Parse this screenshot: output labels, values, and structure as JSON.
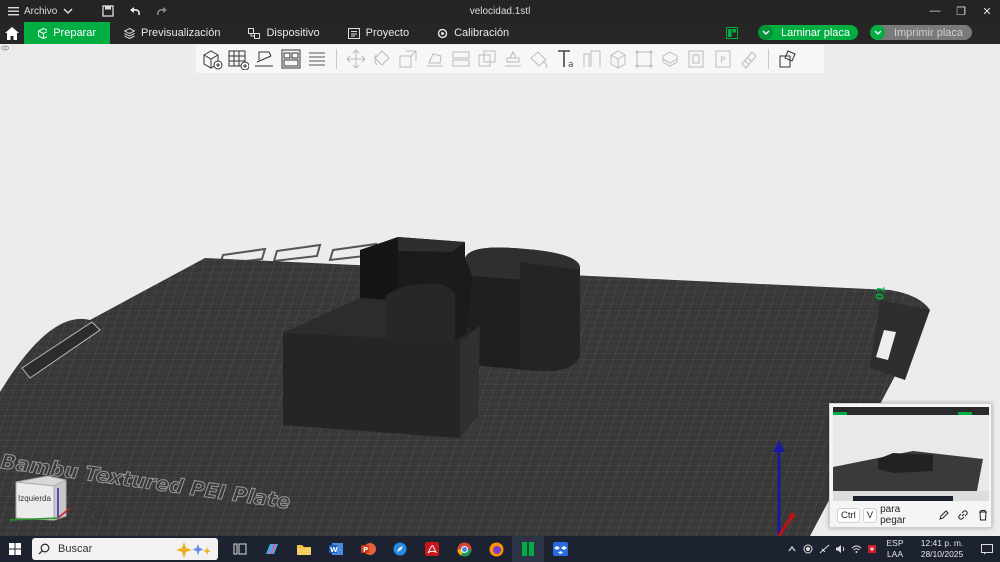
{
  "titlebar": {
    "menu_label": "Archivo",
    "document_title": "velocidad.1stl"
  },
  "nav": {
    "tabs": [
      {
        "label": "Preparar",
        "icon": "cube-icon",
        "active": true
      },
      {
        "label": "Previsualización",
        "icon": "layers-icon",
        "active": false
      },
      {
        "label": "Dispositivo",
        "icon": "device-icon",
        "active": false
      },
      {
        "label": "Proyecto",
        "icon": "project-icon",
        "active": false
      },
      {
        "label": "Calibración",
        "icon": "calibration-icon",
        "active": false
      }
    ],
    "slice_label": "Laminar placa",
    "print_label": "Imprimir placa"
  },
  "toolbar": {
    "tools": [
      "add-object",
      "add-plate",
      "auto-orient",
      "arrange",
      "layer-list",
      "move",
      "rotate",
      "scale",
      "lay-on-face",
      "cut",
      "mesh-boolean",
      "support-paint",
      "seam-paint",
      "text-tool",
      "measure",
      "assembly",
      "variable-layer",
      "split-objects",
      "split-parts",
      "fdm-settings",
      "paint",
      "ruler",
      "return"
    ]
  },
  "plate": {
    "label": "Bambu Textured PEI Plate",
    "plate_number": "01"
  },
  "viewcube": {
    "face_label": "Izquierda"
  },
  "clipboard": {
    "key_ctrl": "Ctrl",
    "key_v": "V",
    "hint": "para pegar"
  },
  "taskbar": {
    "search_placeholder": "Buscar",
    "lang_line1": "ESP",
    "lang_line2": "LAA",
    "time": "12:41 p. m.",
    "date": "28/10/2025"
  },
  "colors": {
    "accent": "#00ae42",
    "plate": "#3a3a3a",
    "model": "#2a2a2a",
    "topbar": "#242424",
    "taskbar": "#1c2230"
  }
}
